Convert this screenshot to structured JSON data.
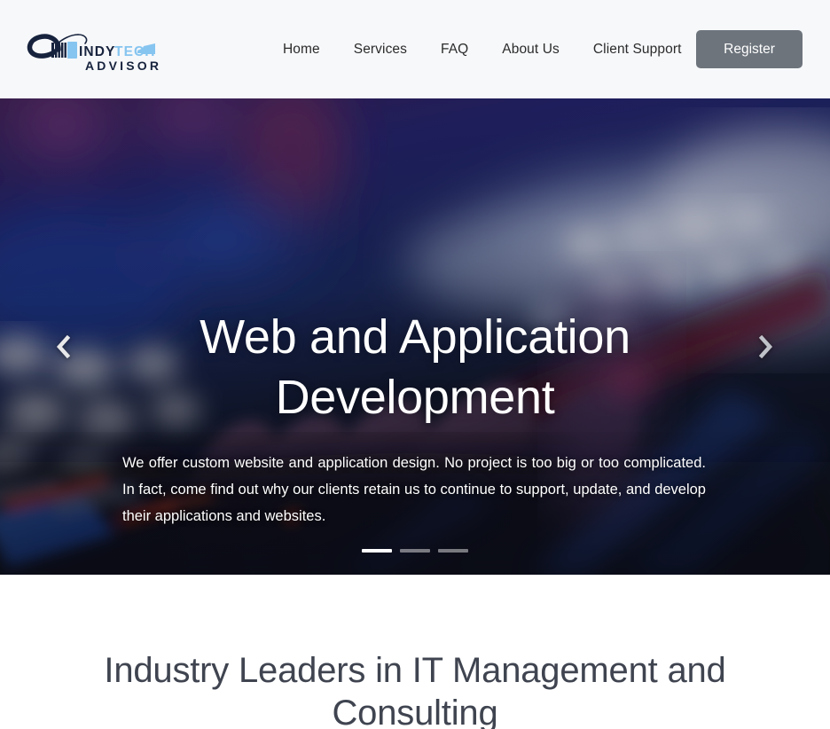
{
  "header": {
    "logo": {
      "icon": "network-cable-icon",
      "name_primary": "INDY",
      "name_secondary": "TECH",
      "name_sub": "ADVISOR",
      "color_dark": "#17233d",
      "color_light": "#86c5f0"
    },
    "nav": [
      {
        "label": "Home"
      },
      {
        "label": "Services"
      },
      {
        "label": "FAQ"
      },
      {
        "label": "About Us"
      },
      {
        "label": "Client Support"
      }
    ],
    "register_label": "Register",
    "register_bg": "#6d747c",
    "background": "#f7f8fa"
  },
  "hero": {
    "title_line1": "Web and Application",
    "title_line2": "Development",
    "paragraph": "We offer custom website and application design. No project is too big or too complicated. In fact, come find out why our clients retain us to continue to support, update, and develop their applications and websites.",
    "prev_icon": "chevron-left-icon",
    "next_icon": "chevron-right-icon",
    "image_alt": "blurred hand typing on backlit keyboard",
    "slide_count": 3,
    "active_slide": 1,
    "indicators": [
      {
        "active": true
      },
      {
        "active": false
      },
      {
        "active": false
      }
    ]
  },
  "section": {
    "title_line1": "Industry Leaders in IT Management and",
    "title_line2": "Consulting",
    "color": "#3f4450"
  }
}
